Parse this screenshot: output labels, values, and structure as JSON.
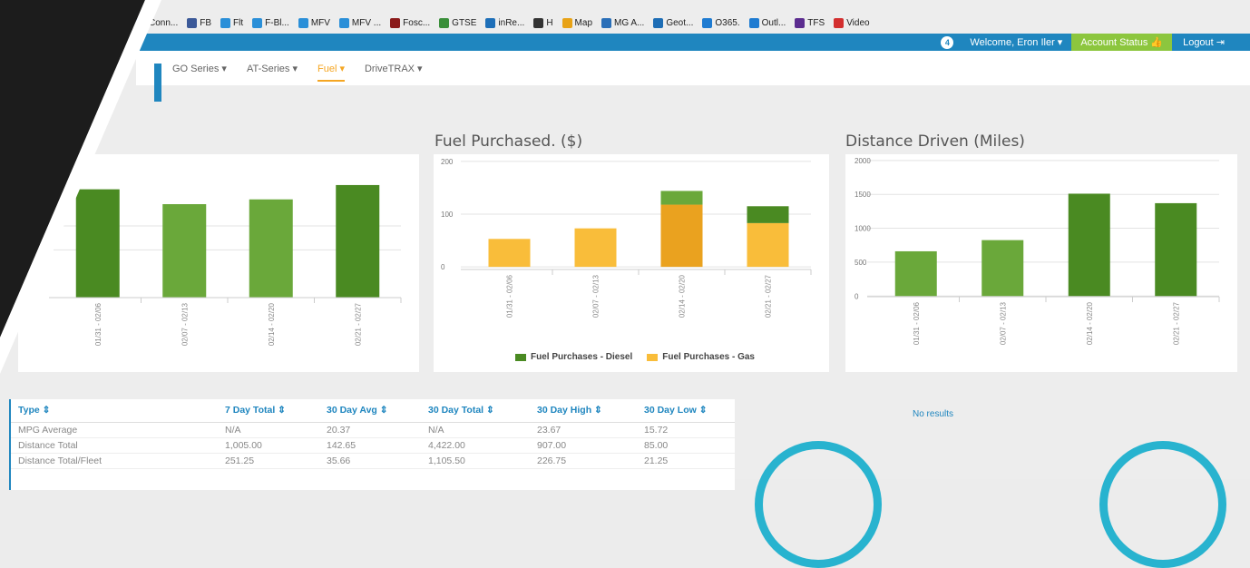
{
  "bookmarks": [
    {
      "label": "Conn...",
      "color": "#3b7bd1"
    },
    {
      "label": "FB",
      "color": "#3b5998"
    },
    {
      "label": "Flt",
      "color": "#2a8fd8"
    },
    {
      "label": "F-Bl...",
      "color": "#2a8fd8"
    },
    {
      "label": "MFV",
      "color": "#2a8fd8"
    },
    {
      "label": "MFV ...",
      "color": "#2a8fd8"
    },
    {
      "label": "Fosc...",
      "color": "#8b1a1a"
    },
    {
      "label": "GTSE",
      "color": "#3a8f3a"
    },
    {
      "label": "inRe...",
      "color": "#1e6fb8"
    },
    {
      "label": "H",
      "color": "#333333"
    },
    {
      "label": "Map",
      "color": "#e8a317"
    },
    {
      "label": "MG A...",
      "color": "#2a6fb8"
    },
    {
      "label": "Geot...",
      "color": "#1d6db5"
    },
    {
      "label": "O365.",
      "color": "#1e7bd1"
    },
    {
      "label": "Outl...",
      "color": "#1e7bd1"
    },
    {
      "label": "TFS",
      "color": "#5b2c8f"
    },
    {
      "label": "Video",
      "color": "#d32f2f"
    }
  ],
  "topbar": {
    "notifications": "4",
    "welcome": "Welcome, Eron Iler ▾",
    "account_status": "Account Status 👍",
    "logout": "Logout ⇥"
  },
  "nav": {
    "items": [
      "GO Series ▾",
      "AT-Series ▾",
      "Fuel ▾",
      "DriveTRAX ▾"
    ],
    "active": "Fuel ▾"
  },
  "colors": {
    "dark_green": "#4a8a22",
    "light_green": "#6aa83a",
    "gas": "#f9bd3a",
    "gas_dark": "#eaa21f",
    "accent_blue": "#1f86bf"
  },
  "charts": {
    "mpg": {
      "title": ""
    },
    "fuel": {
      "title": "Fuel Purchased. ($)",
      "legend": [
        "Fuel Purchases - Diesel",
        "Fuel Purchases - Gas"
      ]
    },
    "distance": {
      "title": "Distance Driven (Miles)"
    }
  },
  "chart_data": [
    {
      "type": "bar",
      "title": "",
      "categories": [
        "01/31 - 02/06",
        "02/07 - 02/13",
        "02/14 - 02/20",
        "02/21 - 02/27"
      ],
      "values": [
        20.4,
        17.6,
        18.5,
        21.2
      ],
      "ylim": [
        0,
        27
      ]
    },
    {
      "type": "bar",
      "title": "Fuel Purchased. ($)",
      "categories": [
        "01/31 - 02/06",
        "02/07 - 02/13",
        "02/14 - 02/20",
        "02/21 - 02/27"
      ],
      "yticks": [
        0,
        100,
        200
      ],
      "ylim": [
        -5,
        205
      ],
      "series": [
        {
          "name": "Fuel Purchases - Gas",
          "values": [
            53,
            73,
            118,
            83
          ]
        },
        {
          "name": "Fuel Purchases - Diesel",
          "values": [
            0,
            0,
            26,
            32
          ]
        }
      ]
    },
    {
      "type": "bar",
      "title": "Distance Driven (Miles)",
      "categories": [
        "01/31 - 02/06",
        "02/07 - 02/13",
        "02/14 - 02/20",
        "02/21 - 02/27"
      ],
      "values": [
        660,
        825,
        1510,
        1370
      ],
      "yticks": [
        0,
        500,
        1000,
        1500,
        2000
      ],
      "ylim": [
        -10,
        2025
      ]
    }
  ],
  "table": {
    "headers": [
      "Type ⇕",
      "7 Day Total ⇕",
      "30 Day Avg ⇕",
      "30 Day Total ⇕",
      "30 Day High ⇕",
      "30 Day Low ⇕"
    ],
    "rows": [
      [
        "MPG Average",
        "N/A",
        "20.37",
        "N/A",
        "23.67",
        "15.72"
      ],
      [
        "Distance Total",
        "1,005.00",
        "142.65",
        "4,422.00",
        "907.00",
        "85.00"
      ],
      [
        "Distance Total/Fleet",
        "251.25",
        "35.66",
        "1,105.50",
        "226.75",
        "21.25"
      ]
    ]
  },
  "no_results": "No results"
}
